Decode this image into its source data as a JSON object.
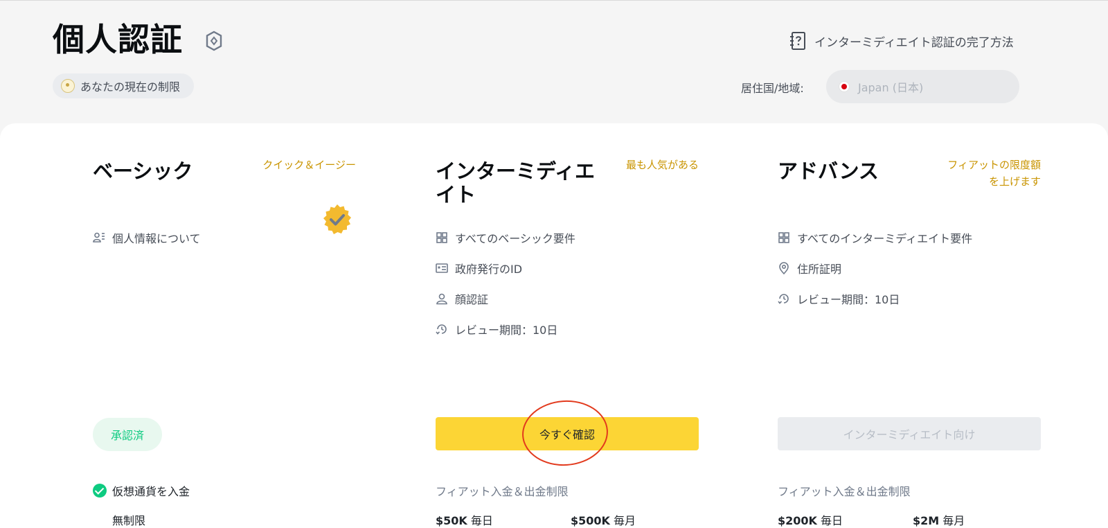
{
  "header": {
    "title": "個人認証",
    "current_limits": "あなたの現在の制限",
    "howto_link": "インターミディエイト認証の完了方法",
    "residence_label": "居住国/地域:",
    "residence_value": "Japan (日本)"
  },
  "tiers": [
    {
      "title": "ベーシック",
      "tag": "クイック＆イージー",
      "requirements": [
        "個人情報について"
      ],
      "status": "承認済",
      "benefit_label": "仮想通貨を入金",
      "benefit_value": "無制限"
    },
    {
      "title": "インターミディエイト",
      "tag": "最も人気がある",
      "requirements": [
        "すべてのベーシック要件",
        "政府発行のID",
        "顔認証",
        "レビュー期間：10日"
      ],
      "button": "今すぐ確認",
      "limit_label": "フィアット入金＆出金制限",
      "daily_amount": "$50K",
      "daily_unit": "毎日",
      "monthly_amount": "$500K",
      "monthly_unit": "毎月"
    },
    {
      "title": "アドバンス",
      "tag": "フィアットの限度額を上げます",
      "requirements": [
        "すべてのインターミディエイト要件",
        "住所証明",
        "レビュー期間：10日"
      ],
      "button": "インターミディエイト向け",
      "limit_label": "フィアット入金＆出金制限",
      "daily_amount": "$200K",
      "daily_unit": "毎日",
      "monthly_amount": "$2M",
      "monthly_unit": "毎月"
    }
  ],
  "colors": {
    "accent": "#fcd535",
    "tag": "#c99400",
    "success": "#0ecb81",
    "annotation": "#e23a1d"
  }
}
